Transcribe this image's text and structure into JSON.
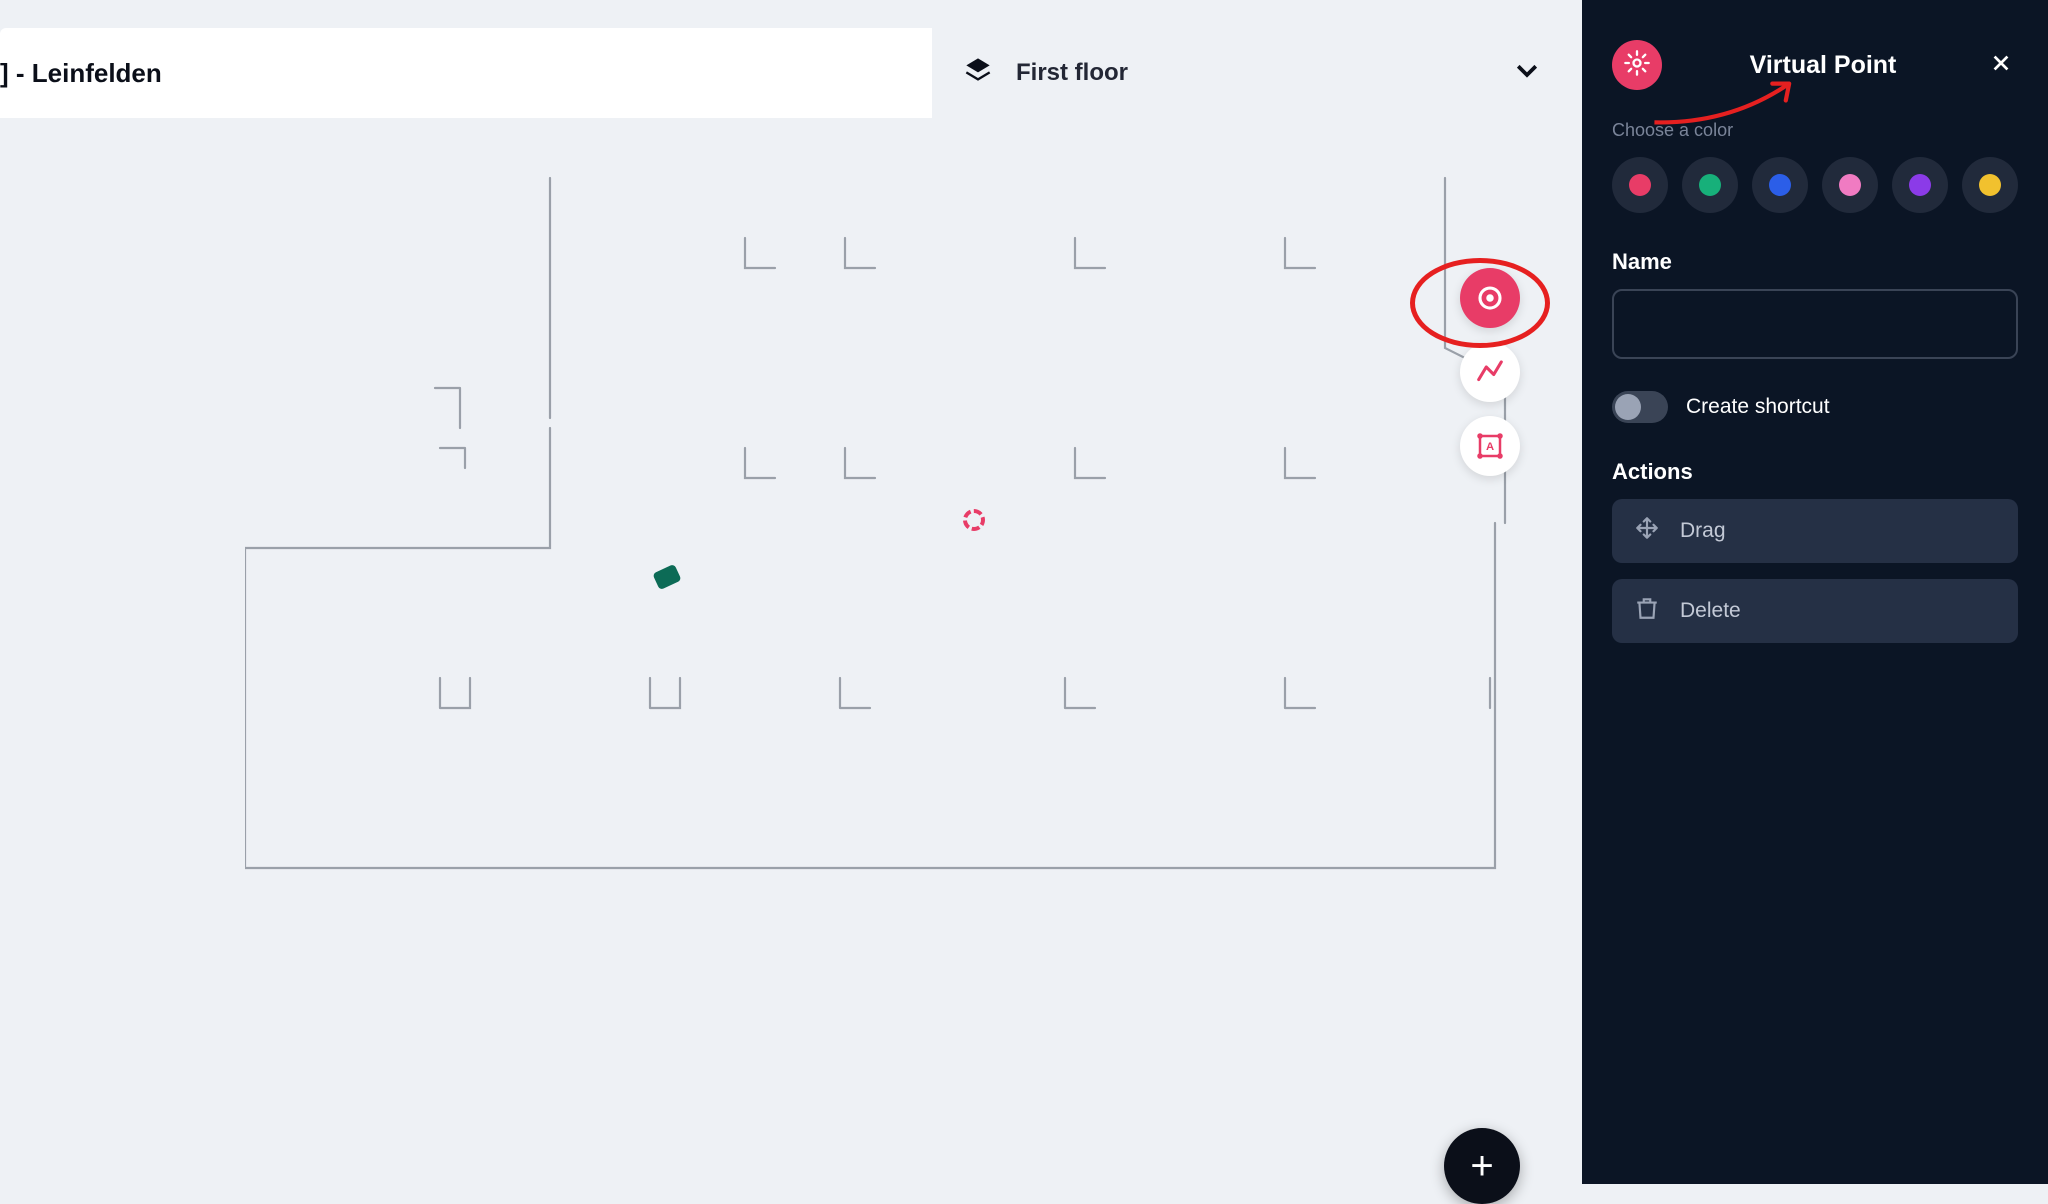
{
  "header": {
    "location": "] - Leinfelden",
    "floor_selector": "First floor"
  },
  "panel": {
    "title": "Virtual Point",
    "hint": "Choose a color",
    "name_label": "Name",
    "name_value": "",
    "toggle_label": "Create shortcut",
    "actions_label": "Actions",
    "drag_label": "Drag",
    "delete_label": "Delete"
  },
  "colors": [
    "#e83c67",
    "#17b07a",
    "#2b5ee8",
    "#f07bc2",
    "#8b3be8",
    "#f1c12e"
  ]
}
